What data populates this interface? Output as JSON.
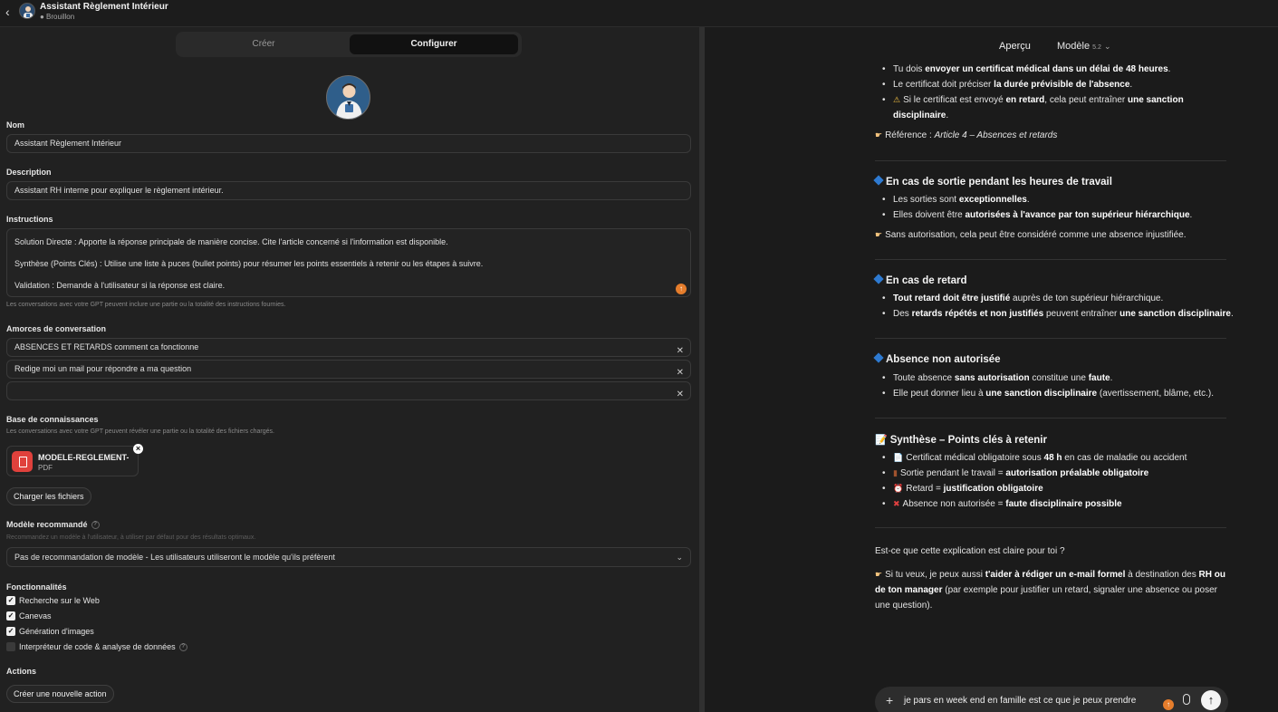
{
  "topbar": {
    "back_icon": "chevron-left-icon",
    "title": "Assistant Règlement Intérieur",
    "status": "● Brouillon"
  },
  "tabs": {
    "create": "Créer",
    "configure": "Configurer"
  },
  "form": {
    "name_label": "Nom",
    "name_value": "Assistant Règlement Intérieur",
    "description_label": "Description",
    "description_value": "Assistant RH interne pour expliquer le règlement intérieur.",
    "instructions_label": "Instructions",
    "instructions_lines": [
      "Solution Directe : Apporte la réponse principale de manière concise. Cite l'article concerné si l'information est disponible.",
      "Synthèse (Points Clés) : Utilise une liste à puces (bullet points) pour résumer les points essentiels à retenir ou les étapes à suivre.",
      "Validation : Demande à l'utilisateur si la réponse est claire."
    ],
    "instructions_hint": "Les conversations avec votre GPT peuvent inclure une partie ou la totalité des instructions fournies.",
    "starters_label": "Amorces de conversation",
    "starters": [
      "ABSENCES ET RETARDS comment ca fonctionne",
      "Redige moi un mail pour répondre a ma question",
      ""
    ],
    "knowledge_label": "Base de connaissances",
    "knowledge_hint": "Les conversations avec votre GPT peuvent révéler une partie ou la totalité des fichiers chargés.",
    "file_name": "MODELE-REGLEMENT-I",
    "file_type": "PDF",
    "upload_button": "Charger les fichiers",
    "model_label": "Modèle recommandé",
    "model_hint": "Recommandez un modèle à l'utilisateur, à utiliser par défaut pour des résultats optimaux.",
    "model_value": "Pas de recommandation de modèle - Les utilisateurs utiliseront le modèle qu'ils préfèrent",
    "capabilities_label": "Fonctionnalités",
    "capabilities": [
      {
        "label": "Recherche sur le Web",
        "checked": true
      },
      {
        "label": "Canevas",
        "checked": true
      },
      {
        "label": "Génération d'images",
        "checked": true
      },
      {
        "label": "Interpréteur de code & analyse de données",
        "checked": false
      }
    ],
    "actions_label": "Actions",
    "new_action_button": "Créer une nouvelle action"
  },
  "preview": {
    "title": "Aperçu",
    "model_label": "Modèle",
    "model_version": "5.2",
    "composer_text": "je pars en week end en famille est ce que je peux prendre"
  }
}
